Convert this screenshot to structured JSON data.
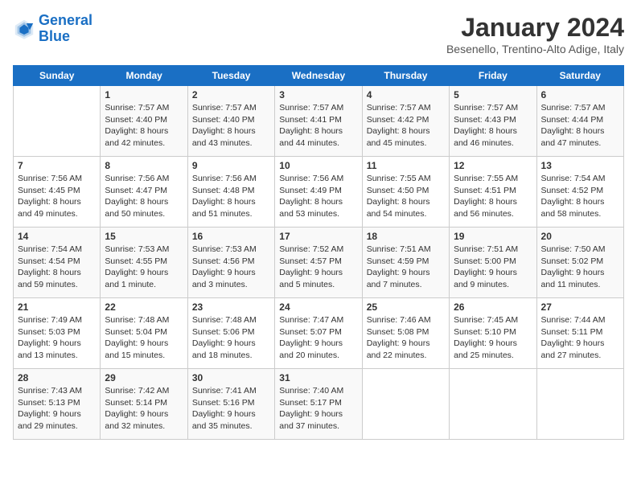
{
  "logo": {
    "line1": "General",
    "line2": "Blue"
  },
  "title": "January 2024",
  "subtitle": "Besenello, Trentino-Alto Adige, Italy",
  "days_of_week": [
    "Sunday",
    "Monday",
    "Tuesday",
    "Wednesday",
    "Thursday",
    "Friday",
    "Saturday"
  ],
  "weeks": [
    [
      {
        "num": "",
        "info": ""
      },
      {
        "num": "1",
        "info": "Sunrise: 7:57 AM\nSunset: 4:40 PM\nDaylight: 8 hours\nand 42 minutes."
      },
      {
        "num": "2",
        "info": "Sunrise: 7:57 AM\nSunset: 4:40 PM\nDaylight: 8 hours\nand 43 minutes."
      },
      {
        "num": "3",
        "info": "Sunrise: 7:57 AM\nSunset: 4:41 PM\nDaylight: 8 hours\nand 44 minutes."
      },
      {
        "num": "4",
        "info": "Sunrise: 7:57 AM\nSunset: 4:42 PM\nDaylight: 8 hours\nand 45 minutes."
      },
      {
        "num": "5",
        "info": "Sunrise: 7:57 AM\nSunset: 4:43 PM\nDaylight: 8 hours\nand 46 minutes."
      },
      {
        "num": "6",
        "info": "Sunrise: 7:57 AM\nSunset: 4:44 PM\nDaylight: 8 hours\nand 47 minutes."
      }
    ],
    [
      {
        "num": "7",
        "info": "Sunrise: 7:56 AM\nSunset: 4:45 PM\nDaylight: 8 hours\nand 49 minutes."
      },
      {
        "num": "8",
        "info": "Sunrise: 7:56 AM\nSunset: 4:47 PM\nDaylight: 8 hours\nand 50 minutes."
      },
      {
        "num": "9",
        "info": "Sunrise: 7:56 AM\nSunset: 4:48 PM\nDaylight: 8 hours\nand 51 minutes."
      },
      {
        "num": "10",
        "info": "Sunrise: 7:56 AM\nSunset: 4:49 PM\nDaylight: 8 hours\nand 53 minutes."
      },
      {
        "num": "11",
        "info": "Sunrise: 7:55 AM\nSunset: 4:50 PM\nDaylight: 8 hours\nand 54 minutes."
      },
      {
        "num": "12",
        "info": "Sunrise: 7:55 AM\nSunset: 4:51 PM\nDaylight: 8 hours\nand 56 minutes."
      },
      {
        "num": "13",
        "info": "Sunrise: 7:54 AM\nSunset: 4:52 PM\nDaylight: 8 hours\nand 58 minutes."
      }
    ],
    [
      {
        "num": "14",
        "info": "Sunrise: 7:54 AM\nSunset: 4:54 PM\nDaylight: 8 hours\nand 59 minutes."
      },
      {
        "num": "15",
        "info": "Sunrise: 7:53 AM\nSunset: 4:55 PM\nDaylight: 9 hours\nand 1 minute."
      },
      {
        "num": "16",
        "info": "Sunrise: 7:53 AM\nSunset: 4:56 PM\nDaylight: 9 hours\nand 3 minutes."
      },
      {
        "num": "17",
        "info": "Sunrise: 7:52 AM\nSunset: 4:57 PM\nDaylight: 9 hours\nand 5 minutes."
      },
      {
        "num": "18",
        "info": "Sunrise: 7:51 AM\nSunset: 4:59 PM\nDaylight: 9 hours\nand 7 minutes."
      },
      {
        "num": "19",
        "info": "Sunrise: 7:51 AM\nSunset: 5:00 PM\nDaylight: 9 hours\nand 9 minutes."
      },
      {
        "num": "20",
        "info": "Sunrise: 7:50 AM\nSunset: 5:02 PM\nDaylight: 9 hours\nand 11 minutes."
      }
    ],
    [
      {
        "num": "21",
        "info": "Sunrise: 7:49 AM\nSunset: 5:03 PM\nDaylight: 9 hours\nand 13 minutes."
      },
      {
        "num": "22",
        "info": "Sunrise: 7:48 AM\nSunset: 5:04 PM\nDaylight: 9 hours\nand 15 minutes."
      },
      {
        "num": "23",
        "info": "Sunrise: 7:48 AM\nSunset: 5:06 PM\nDaylight: 9 hours\nand 18 minutes."
      },
      {
        "num": "24",
        "info": "Sunrise: 7:47 AM\nSunset: 5:07 PM\nDaylight: 9 hours\nand 20 minutes."
      },
      {
        "num": "25",
        "info": "Sunrise: 7:46 AM\nSunset: 5:08 PM\nDaylight: 9 hours\nand 22 minutes."
      },
      {
        "num": "26",
        "info": "Sunrise: 7:45 AM\nSunset: 5:10 PM\nDaylight: 9 hours\nand 25 minutes."
      },
      {
        "num": "27",
        "info": "Sunrise: 7:44 AM\nSunset: 5:11 PM\nDaylight: 9 hours\nand 27 minutes."
      }
    ],
    [
      {
        "num": "28",
        "info": "Sunrise: 7:43 AM\nSunset: 5:13 PM\nDaylight: 9 hours\nand 29 minutes."
      },
      {
        "num": "29",
        "info": "Sunrise: 7:42 AM\nSunset: 5:14 PM\nDaylight: 9 hours\nand 32 minutes."
      },
      {
        "num": "30",
        "info": "Sunrise: 7:41 AM\nSunset: 5:16 PM\nDaylight: 9 hours\nand 35 minutes."
      },
      {
        "num": "31",
        "info": "Sunrise: 7:40 AM\nSunset: 5:17 PM\nDaylight: 9 hours\nand 37 minutes."
      },
      {
        "num": "",
        "info": ""
      },
      {
        "num": "",
        "info": ""
      },
      {
        "num": "",
        "info": ""
      }
    ]
  ]
}
